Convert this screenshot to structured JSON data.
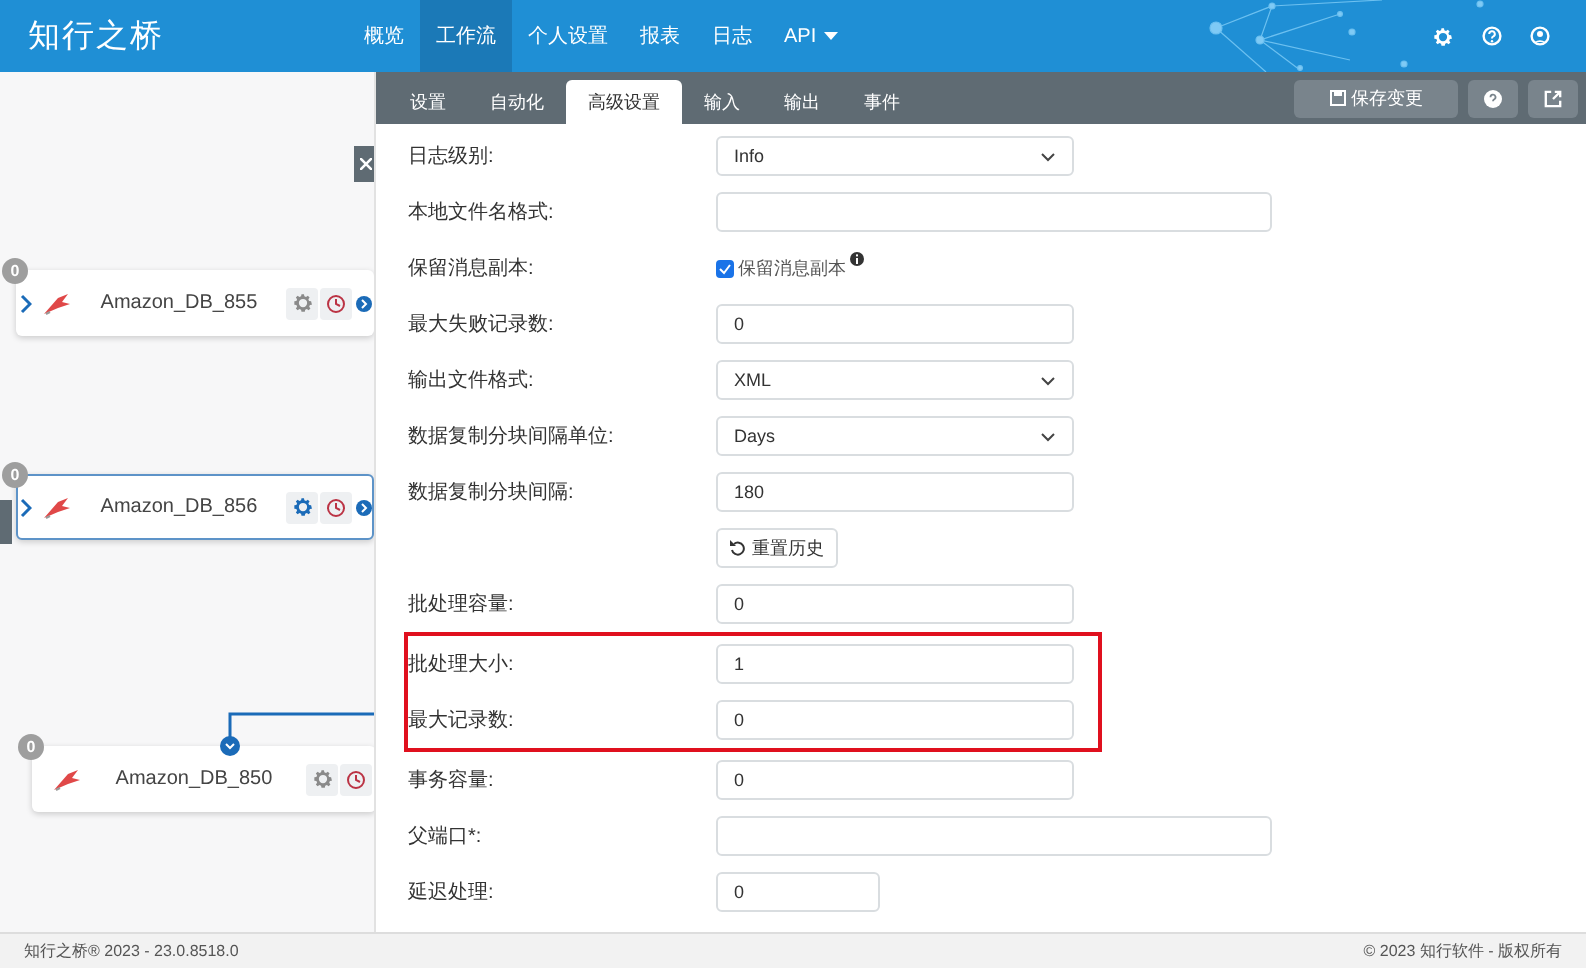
{
  "header": {
    "logo": "知行之桥",
    "nav": [
      {
        "label": "概览",
        "selected": false,
        "dropdown": false
      },
      {
        "label": "工作流",
        "selected": true,
        "dropdown": false
      },
      {
        "label": "个人设置",
        "selected": false,
        "dropdown": false
      },
      {
        "label": "报表",
        "selected": false,
        "dropdown": false
      },
      {
        "label": "日志",
        "selected": false,
        "dropdown": false
      },
      {
        "label": "API",
        "selected": false,
        "dropdown": true
      }
    ]
  },
  "canvas": {
    "nodes": [
      {
        "name": "Amazon_DB_855",
        "badge": "0",
        "selected": false,
        "kind": "side"
      },
      {
        "name": "Amazon_DB_856",
        "badge": "0",
        "selected": true,
        "kind": "side"
      },
      {
        "name": "Amazon_DB_850",
        "badge": "0",
        "selected": false,
        "kind": "top"
      }
    ]
  },
  "panel": {
    "tabs": [
      {
        "label": "设置",
        "selected": false
      },
      {
        "label": "自动化",
        "selected": false
      },
      {
        "label": "高级设置",
        "selected": true
      },
      {
        "label": "输入",
        "selected": false
      },
      {
        "label": "输出",
        "selected": false
      },
      {
        "label": "事件",
        "selected": false
      }
    ],
    "save_button": "保存变更",
    "rows": [
      {
        "kind": "select",
        "label": "日志级别:",
        "value": "Info",
        "highlighted": false
      },
      {
        "kind": "widetext",
        "label": "本地文件名格式:",
        "highlighted": false
      },
      {
        "kind": "checkbox",
        "label": "保留消息副本:",
        "option": "保留消息副本",
        "checked": true,
        "highlighted": false
      },
      {
        "kind": "text",
        "label": "最大失败记录数:",
        "value": "0",
        "highlighted": false
      },
      {
        "kind": "select",
        "label": "输出文件格式:",
        "value": "XML",
        "highlighted": false
      },
      {
        "kind": "select",
        "label": "数据复制分块间隔单位:",
        "value": "Days",
        "highlighted": false
      },
      {
        "kind": "text",
        "label": "数据复制分块间隔:",
        "value": "180",
        "highlighted": false
      },
      {
        "kind": "button",
        "value": "重置历史",
        "highlighted": false
      },
      {
        "kind": "text",
        "label": "批处理容量:",
        "value": "0",
        "highlighted": false
      },
      {
        "kind": "text",
        "label": "批处理大小:",
        "value": "1",
        "highlighted": true
      },
      {
        "kind": "text",
        "label": "最大记录数:",
        "value": "0",
        "highlighted": true
      },
      {
        "kind": "text",
        "label": "事务容量:",
        "value": "0",
        "highlighted": false
      },
      {
        "kind": "widetext",
        "label": "父端口*:",
        "highlighted": false
      },
      {
        "kind": "shorttext",
        "label": "延迟处理:",
        "value": "0",
        "highlighted": false
      }
    ]
  },
  "footer": {
    "left": "知行之桥® 2023 - 23.0.8518.0",
    "right": "© 2023 知行软件 - 版权所有"
  }
}
